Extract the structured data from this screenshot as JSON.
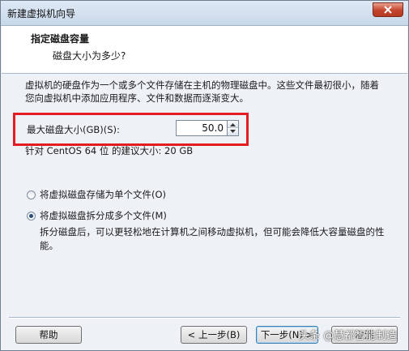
{
  "window": {
    "title": "新建虚拟机向导"
  },
  "header": {
    "title": "指定磁盘容量",
    "subtitle": "磁盘大小为多少?"
  },
  "description": "虚拟机的硬盘作为一个或多个文件存储在主机的物理磁盘中。这些文件最初很小，随着您向虚拟机中添加应用程序、文件和数据而逐渐变大。",
  "disk_size": {
    "label": "最大磁盘大小(GB)(S):",
    "value": "50.0"
  },
  "recommendation": "针对 CentOS 64 位 的建议大小: 20 GB",
  "options": [
    {
      "label": "将虚拟磁盘存储为单个文件(O)",
      "checked": false
    },
    {
      "label": "将虚拟磁盘拆分成多个文件(M)",
      "checked": true
    }
  ],
  "split_note": "拆分磁盘后，可以更轻松地在计算机之间移动虚拟机，但可能会降低大容量磁盘的性能。",
  "buttons": {
    "help": "帮助",
    "back": "< 上一步(B)",
    "next": "下一步(N) >",
    "cancel": "取消"
  },
  "watermark": "头条 @慧都智能制造",
  "colors": {
    "highlight": "#e31b23",
    "header_bg": "#ffffff",
    "body_bg": "#eef2f7"
  }
}
